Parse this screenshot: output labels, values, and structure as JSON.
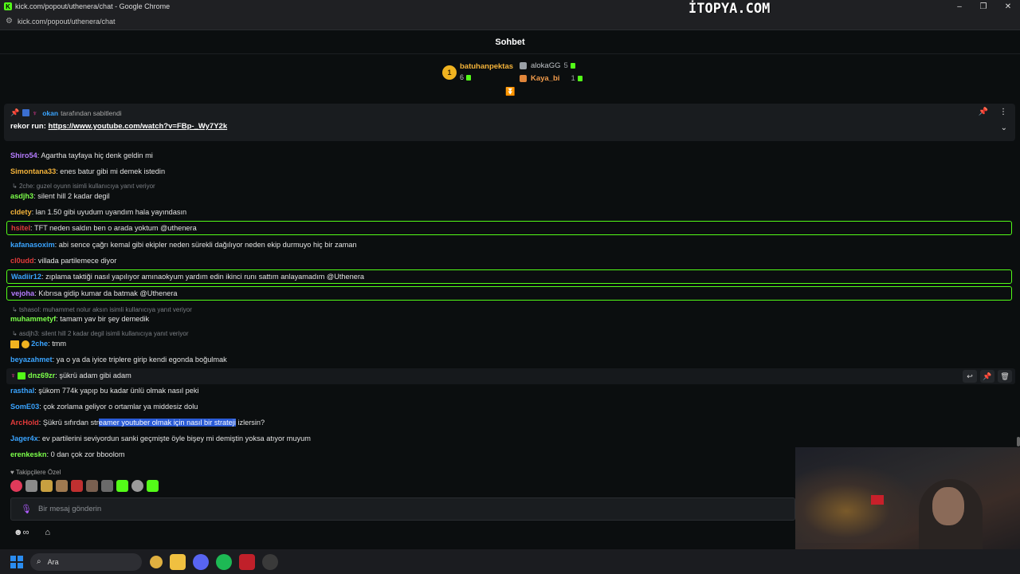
{
  "window": {
    "title": "kick.com/popout/uthenera/chat - Google Chrome",
    "watermark": "İTOPYA.COM",
    "url": "kick.com/popout/uthenera/chat"
  },
  "chat": {
    "title": "Sohbet",
    "top_gifters": [
      {
        "rank": "1",
        "name": "batuhanpektas",
        "count": "6"
      },
      {
        "rank": "",
        "name": "alokaGG",
        "count": "5"
      },
      {
        "rank": "",
        "name": "Kaya_bi",
        "count": "1"
      }
    ],
    "pinned": {
      "pinned_by_user": "okan",
      "pinned_by_text": "tarafından sabitlendi",
      "prefix": "rekor run:",
      "link": "https://www.youtube.com/watch?v=FBp-_Wy7Y2k"
    },
    "messages": [
      {
        "user": "Shiro54",
        "color": "#b57cff",
        "text": "Agartha tayfaya hiç denk geldin mi"
      },
      {
        "user": "Simontana33",
        "color": "#f4b33a",
        "text": "enes batur gibi mi demek istedin"
      },
      {
        "reply": "2che: guzel oyunn isimli kullanıcıya yanıt veriyor"
      },
      {
        "user": "asdjh3",
        "color": "#7cff4a",
        "text": "silent hill 2 kadar degil"
      },
      {
        "user": "cldety",
        "color": "#f4b33a",
        "text": "lan 1.50 gibi uyudum uyandım hala yayındasın"
      },
      {
        "user": "hsitel",
        "color": "#e23a3a",
        "text": "TFT neden saldın ben o arada yoktum @uthenera",
        "highlight": true
      },
      {
        "user": "kafanasoxim",
        "color": "#3aa4ff",
        "text": "abi sence çağrı kemal gibi ekipler neden sürekli dağılıyor neden ekip durmuyo hiç bir zaman"
      },
      {
        "user": "cl0udd",
        "color": "#e23a3a",
        "text": "villada partilemece diyor"
      },
      {
        "user": "Wadiir12",
        "color": "#3aa4ff",
        "text": "zıplama taktiği nasıl yapılıyor amınaokyum yardım edin ikinci runı sattım anlayamadım @Uthenera",
        "highlight": true
      },
      {
        "user": "vejoha",
        "color": "#b57cff",
        "text": "Kıbrısa gidip kumar da batmak @Uthenera",
        "highlight": true
      },
      {
        "reply": "tshasol: muhammet nolur aksın isimli kullanıcıya yanıt veriyor"
      },
      {
        "user": "muhammetyf",
        "color": "#7cff4a",
        "text": "tamam yav bir şey demedik"
      },
      {
        "reply": "asdjh3: silent hill 2 kadar degil isimli kullanıcıya yanıt veriyor"
      },
      {
        "user": "2che",
        "color": "#3aa4ff",
        "text": "tmm"
      },
      {
        "user": "beyazahmet",
        "color": "#3aa4ff",
        "text": "ya o ya da iyice triplere girip kendi egonda boğulmak"
      },
      {
        "user": "dnz69zr",
        "color": "#7cff4a",
        "text": "şükrü adam gibi adam"
      },
      {
        "user": "rasthal",
        "color": "#3aa4ff",
        "text": "şükom 774k yapıp bu kadar ünlü olmak nasıl peki"
      },
      {
        "user": "SomE03",
        "color": "#3aa4ff",
        "text": "çok zorlama geliyor o ortamlar ya middesiz dolu"
      },
      {
        "user": "ArcHold",
        "color": "#e23a3a",
        "text_before": "Şükrü sıfırdan str",
        "text_selected": "eamer youtuber olmak için nasıl bir strateji",
        "text_after": " izlersin?"
      },
      {
        "user": "Jager4x",
        "color": "#3aa4ff",
        "text": "ev partilerini seviyordun sanki geçmişte öyle bişey mi demiştin yoksa atıyor muyum"
      },
      {
        "user": "erenkeskn",
        "color": "#7cff4a",
        "text": "0 dan çok zor bboolom"
      }
    ],
    "emotes_label": "Takipçilere Özel",
    "input_placeholder": "Bir mesaj gönderin"
  },
  "taskbar": {
    "search_label": "Ara"
  }
}
